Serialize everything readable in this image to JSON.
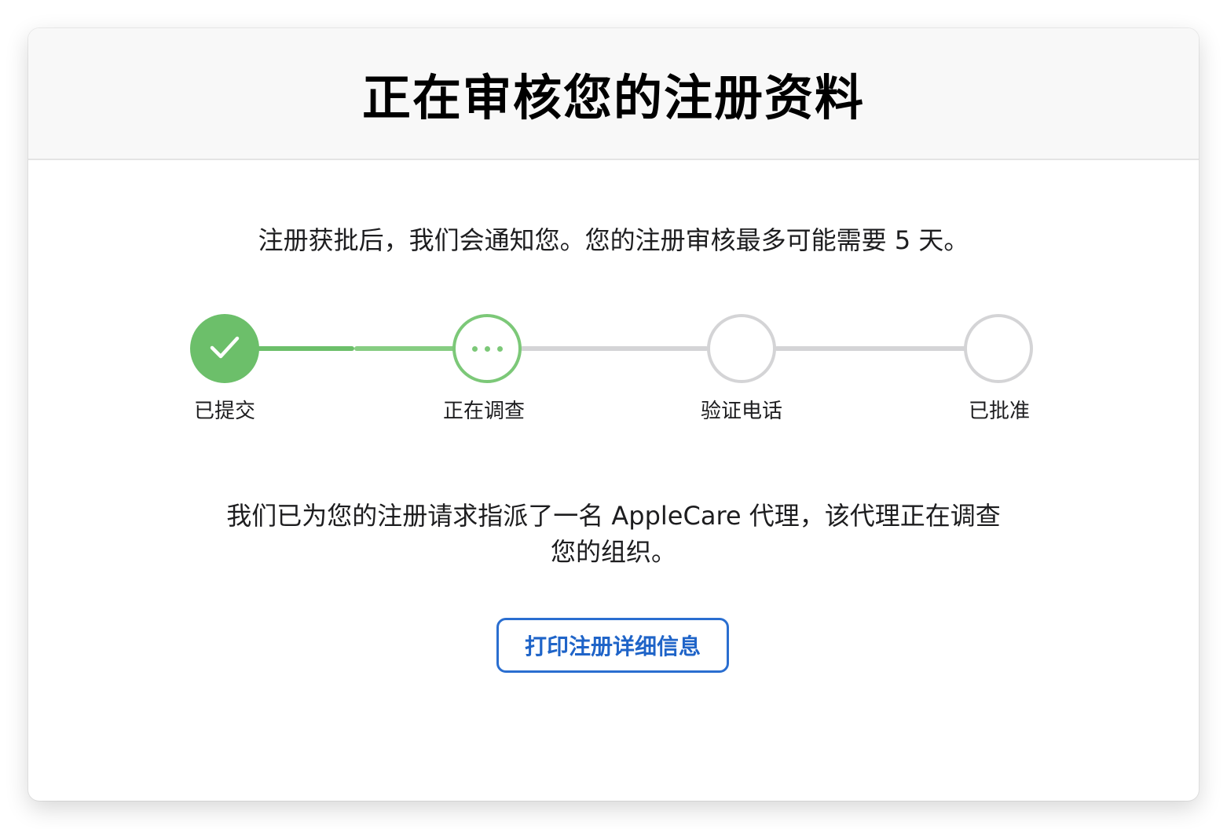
{
  "header": {
    "title": "正在审核您的注册资料"
  },
  "intro_text": "注册获批后，我们会通知您。您的注册审核最多可能需要 5 天。",
  "steps": [
    {
      "label": "已提交",
      "status": "completed",
      "icon": "checkmark-icon"
    },
    {
      "label": "正在调查",
      "status": "in-progress",
      "icon": "ellipsis-icon"
    },
    {
      "label": "验证电话",
      "status": "pending"
    },
    {
      "label": "已批准",
      "status": "pending"
    }
  ],
  "agent_text": "我们已为您的注册请求指派了一名 AppleCare 代理，该代理正在调查您的组织。",
  "print_button_label": "打印注册详细信息",
  "colors": {
    "completed": "#6cbf6a",
    "in_progress": "#7cc878",
    "pending": "#d4d4d6",
    "button_blue": "#2a6ed0",
    "header_bg": "#f8f8f8"
  }
}
